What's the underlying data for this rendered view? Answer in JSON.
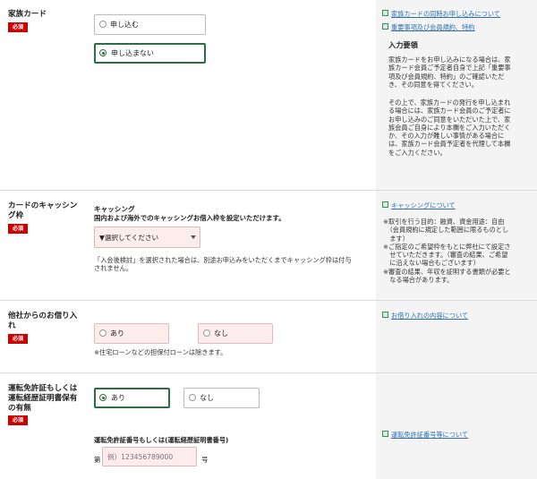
{
  "family": {
    "label": "家族カード",
    "required": "必須",
    "opt1": "申し込む",
    "opt2": "申し込まない",
    "link1": "家族カードの同時お申し込みについて",
    "link2": "重要事項及び会員規約、特約",
    "heading": "入力要領",
    "p1": [
      "家族カードをお申し込みになる場合は、家",
      "族カード会員ご予定者自身で上記「重要事",
      "項及び会員規約、特約」のご確認いただ",
      "き、その同意を得てください。"
    ],
    "p2": [
      "その上で、家族カードの発行を申し込まれ",
      "る場合には、家族カード会員のご予定者に",
      "お申し込みのご同意をいただいた上で、家",
      "族会員ご自身により本欄をご入力いただく",
      "か、その入力が難しい事情がある場合に",
      "は、家族カード会員予定者を代理して本欄",
      "をご入力ください。"
    ]
  },
  "cashing": {
    "label_lines": [
      "カードのキャッシン",
      "グ枠"
    ],
    "required": "必須",
    "heading": "キャッシング",
    "subheading": "国内および海外でのキャッシングお借入枠を設定いただけます。",
    "select_value": "▼選択してください",
    "note": [
      "「入会後検討」を選択された場合は、別途お申込みをいただくまでキャッシング枠は付与",
      "されません。"
    ],
    "link": "キャッシングについて",
    "side_notes": [
      "※取引を行う目的：融資、資金用途：自由",
      "　（会員規約に規定した範囲に限るものとし",
      "　ます）",
      "※ご指定のご希望枠をもとに弊社にて設定さ",
      "　せていただきます。（審査の結果、ご希望",
      "　に沿えない場合もございます）",
      "※審査の結果、年収を証明する書類が必要と",
      "　なる場合があります。"
    ]
  },
  "borrowing": {
    "label_lines": [
      "他社からのお借り入",
      "れ"
    ],
    "required": "必須",
    "opt1": "あり",
    "opt2": "なし",
    "note": "※住宅ローンなどの担保付ローンは除きます。",
    "link": "お借り入れの内容について"
  },
  "license": {
    "label_lines": [
      "運転免許証もしくは",
      "運転経歴証明書保有",
      "の有無"
    ],
    "required": "必須",
    "opt1": "あり",
    "opt2": "なし",
    "number_heading": "運転免許証番号もしくは(運転経歴証明書番号)",
    "prefix": "第",
    "placeholder": "例）123456789000",
    "suffix": "号",
    "link": "運転免許証番号等について"
  }
}
